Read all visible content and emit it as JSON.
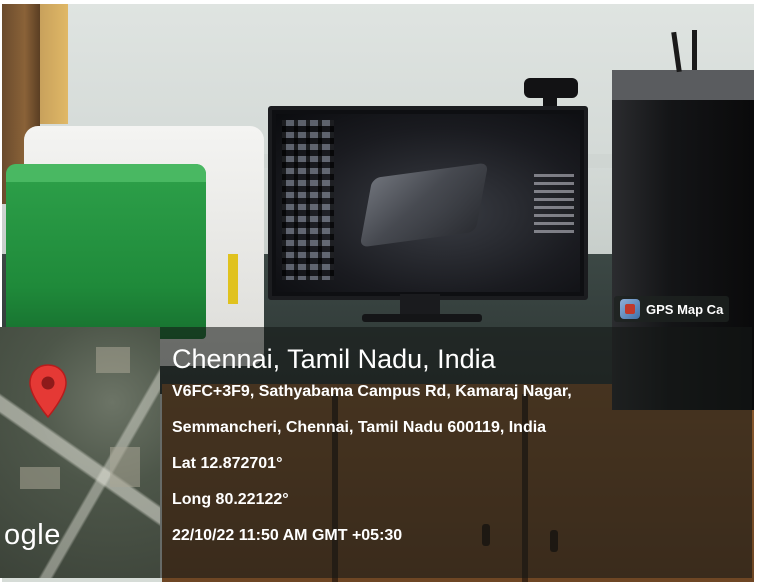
{
  "gps_stamp": {
    "app_name": "GPS Map Ca",
    "location_title": "Chennai, Tamil Nadu, India",
    "address_line_1": "V6FC+3F9, Sathyabama Campus Rd, Kamaraj Nagar,",
    "address_line_2": "Semmancheri, Chennai, Tamil Nadu 600119, India",
    "latitude": "Lat 12.872701°",
    "longitude": "Long 80.22122°",
    "datetime": "22/10/22 11:50 AM GMT +05:30",
    "map_brand": "ogle"
  },
  "colors": {
    "overlay": "#141816",
    "pin": "#e53935",
    "text": "#ffffff"
  },
  "icons": {
    "pin": "map-pin-icon",
    "app": "gps-map-camera-logo-icon"
  }
}
